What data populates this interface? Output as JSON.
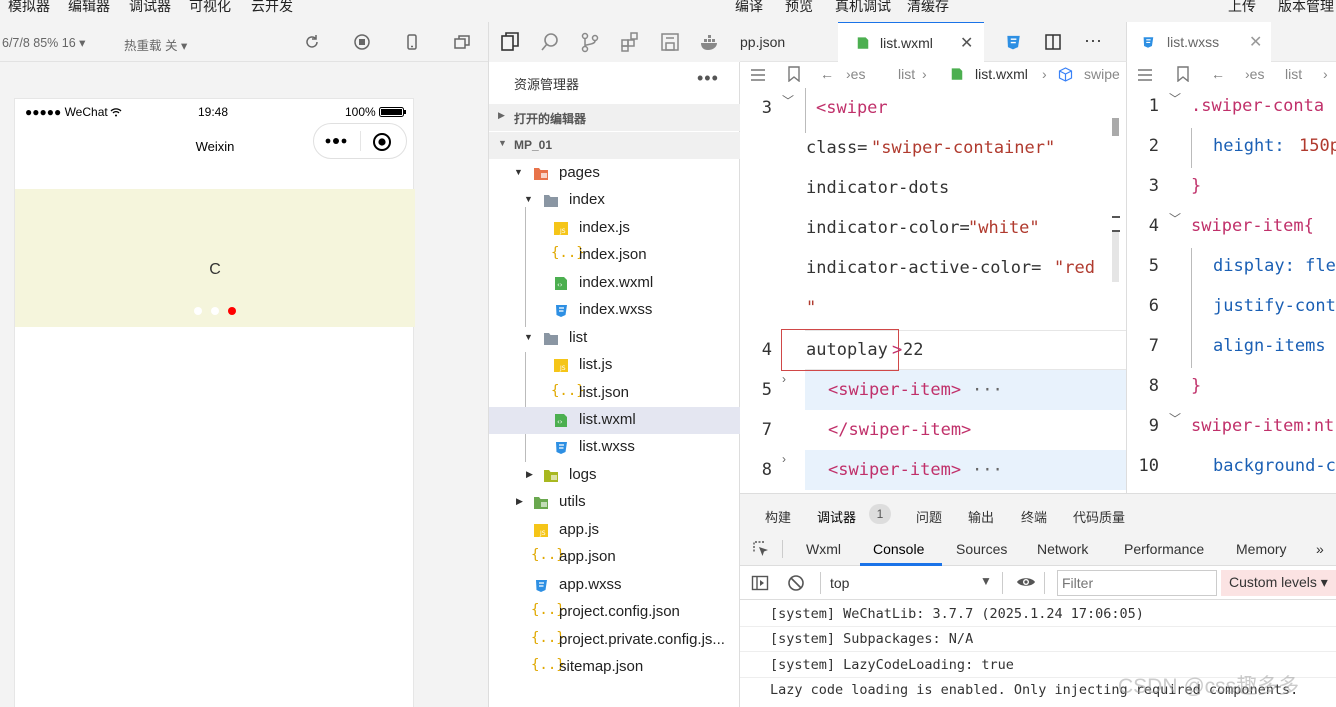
{
  "menubar": {
    "left": [
      "模拟器",
      "编辑器",
      "调试器",
      "可视化",
      "云开发"
    ],
    "right": [
      "编译",
      "预览",
      "真机调试",
      "清缓存"
    ],
    "far_right": [
      "上传",
      "版本管理"
    ]
  },
  "simulator": {
    "device_label": "6/7/8 85% 16 ▾",
    "hot_reload": "热重载 关 ▾",
    "carrier": "●●●●● WeChat",
    "time": "19:48",
    "battery": "100%",
    "nav_title": "Weixin",
    "swiper_text": "C",
    "swiper_bg": "#f5f5dc",
    "indicator_active": "#ff0000",
    "indicator_inactive": "#ffffff"
  },
  "explorer": {
    "title": "资源管理器",
    "more": "•••",
    "open_editors": "打开的编辑器",
    "project": "MP_01",
    "tree": [
      {
        "name": "pages",
        "type": "folder-red"
      },
      {
        "name": "index",
        "type": "folder"
      },
      {
        "name": "index.js",
        "type": "js"
      },
      {
        "name": "index.json",
        "type": "json"
      },
      {
        "name": "index.wxml",
        "type": "wxml"
      },
      {
        "name": "index.wxss",
        "type": "wxss"
      },
      {
        "name": "list",
        "type": "folder"
      },
      {
        "name": "list.js",
        "type": "js"
      },
      {
        "name": "list.json",
        "type": "json"
      },
      {
        "name": "list.wxml",
        "type": "wxml"
      },
      {
        "name": "list.wxss",
        "type": "wxss"
      },
      {
        "name": "logs",
        "type": "folder-green"
      },
      {
        "name": "utils",
        "type": "folder-green"
      },
      {
        "name": "app.js",
        "type": "js"
      },
      {
        "name": "app.json",
        "type": "json"
      },
      {
        "name": "app.wxss",
        "type": "wxss"
      },
      {
        "name": "project.config.json",
        "type": "json"
      },
      {
        "name": "project.private.config.js...",
        "type": "json"
      },
      {
        "name": "sitemap.json",
        "type": "json"
      }
    ]
  },
  "editor_left": {
    "tab_prev": "pp.json",
    "tab_active": "list.wxml",
    "close": "✕",
    "more": "···",
    "crumbs": [
      "›es",
      "›",
      "list",
      "›",
      "list.wxml",
      "›",
      "swipe"
    ],
    "line_numbers": [
      "3",
      "4",
      "5",
      "7",
      "8"
    ],
    "code": {
      "l1": "<swiper",
      "l2a": "class=",
      "l2b": "\"swiper-container\"",
      "l3": "indicator-dots",
      "l4a": "indicator-color=",
      "l4b": "\"white\"",
      "l5a": "indicator-active-color=",
      "l5b": "\"red",
      "l6": "\"",
      "l7a": "autoplay",
      "l7b": ">",
      "l7c": "22",
      "l8": "<swiper-item>",
      "l8e": "···",
      "l9": "</swiper-item>",
      "l10": "<swiper-item>",
      "l10e": "···"
    }
  },
  "editor_right": {
    "tab_active": "list.wxss",
    "close": "✕",
    "crumbs": [
      "›es",
      "›",
      "list",
      "›"
    ],
    "line_numbers": [
      "1",
      "2",
      "3",
      "4",
      "5",
      "6",
      "7",
      "8",
      "9",
      "10"
    ],
    "code": {
      "l1": ".swiper-conta",
      "l2a": "height: ",
      "l2b": "150p",
      "l3": "}",
      "l4": "swiper-item{",
      "l5": "display: fle",
      "l6": "justify-cont",
      "l7": "align-items",
      "l8": "}",
      "l9": "swiper-item:nt",
      "l10": "background-c"
    }
  },
  "devtools": {
    "top_tabs": [
      "构建",
      "调试器",
      "问题",
      "输出",
      "终端",
      "代码质量"
    ],
    "badge": "1",
    "panel_tabs": [
      "Wxml",
      "Console",
      "Sources",
      "Network",
      "Performance",
      "Memory",
      "»"
    ],
    "context": "top",
    "filter_placeholder": "Filter",
    "levels": "Custom levels ▾",
    "logs": [
      "[system] WeChatLib: 3.7.7 (2025.1.24 17:06:05)",
      "[system] Subpackages: N/A",
      "[system] LazyCodeLoading: true",
      "Lazy code loading is enabled. Only injecting required components."
    ]
  },
  "watermark": "CSDN @css趣多多",
  "colors": {
    "accent": "#1a73e8",
    "tag": "#c0306a",
    "string": "#b03a2e",
    "property": "#1a5fb4"
  }
}
